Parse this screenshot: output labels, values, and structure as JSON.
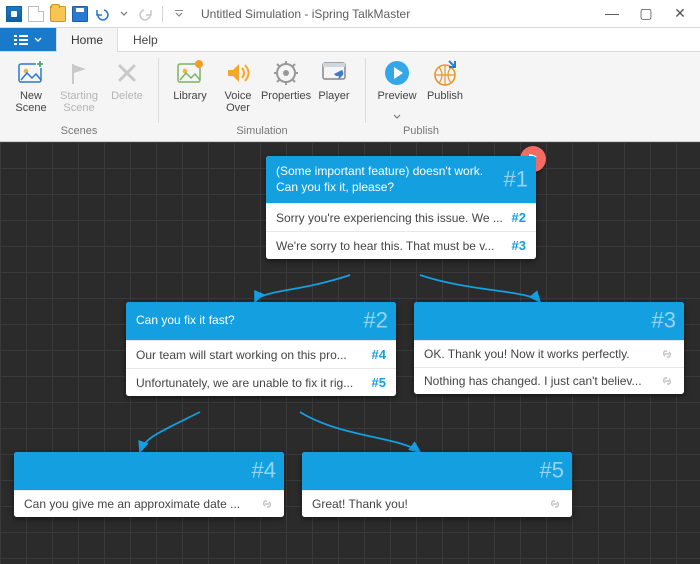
{
  "window": {
    "title": "Untitled Simulation - iSpring TalkMaster"
  },
  "tabs": {
    "home": "Home",
    "help": "Help"
  },
  "ribbon": {
    "scenes": {
      "group_label": "Scenes",
      "new_scene": "New Scene",
      "starting_scene": "Starting Scene",
      "delete": "Delete"
    },
    "simulation": {
      "group_label": "Simulation",
      "library": "Library",
      "voice_over": "Voice Over",
      "properties": "Properties",
      "player": "Player"
    },
    "publish": {
      "group_label": "Publish",
      "preview": "Preview",
      "publish": "Publish"
    }
  },
  "nodes": {
    "n1": {
      "num": "#1",
      "question": "(Some important feature) doesn't work. Can you fix it, please?",
      "replies": [
        {
          "text": "Sorry you're experiencing this issue. We ...",
          "tag": "#2"
        },
        {
          "text": "We're sorry to hear this. That must be v...",
          "tag": "#3"
        }
      ]
    },
    "n2": {
      "num": "#2",
      "question": "Can you fix it fast?",
      "replies": [
        {
          "text": "Our team will start working on this pro...",
          "tag": "#4"
        },
        {
          "text": "Unfortunately, we are unable to fix it rig...",
          "tag": "#5"
        }
      ]
    },
    "n3": {
      "num": "#3",
      "question": "",
      "replies": [
        {
          "text": "OK. Thank you! Now it works perfectly."
        },
        {
          "text": "Nothing has changed. I just can't believ..."
        }
      ]
    },
    "n4": {
      "num": "#4",
      "question": "",
      "replies": [
        {
          "text": "Can you give me an approximate date ..."
        }
      ]
    },
    "n5": {
      "num": "#5",
      "question": "",
      "replies": [
        {
          "text": "Great! Thank you!"
        }
      ]
    }
  }
}
